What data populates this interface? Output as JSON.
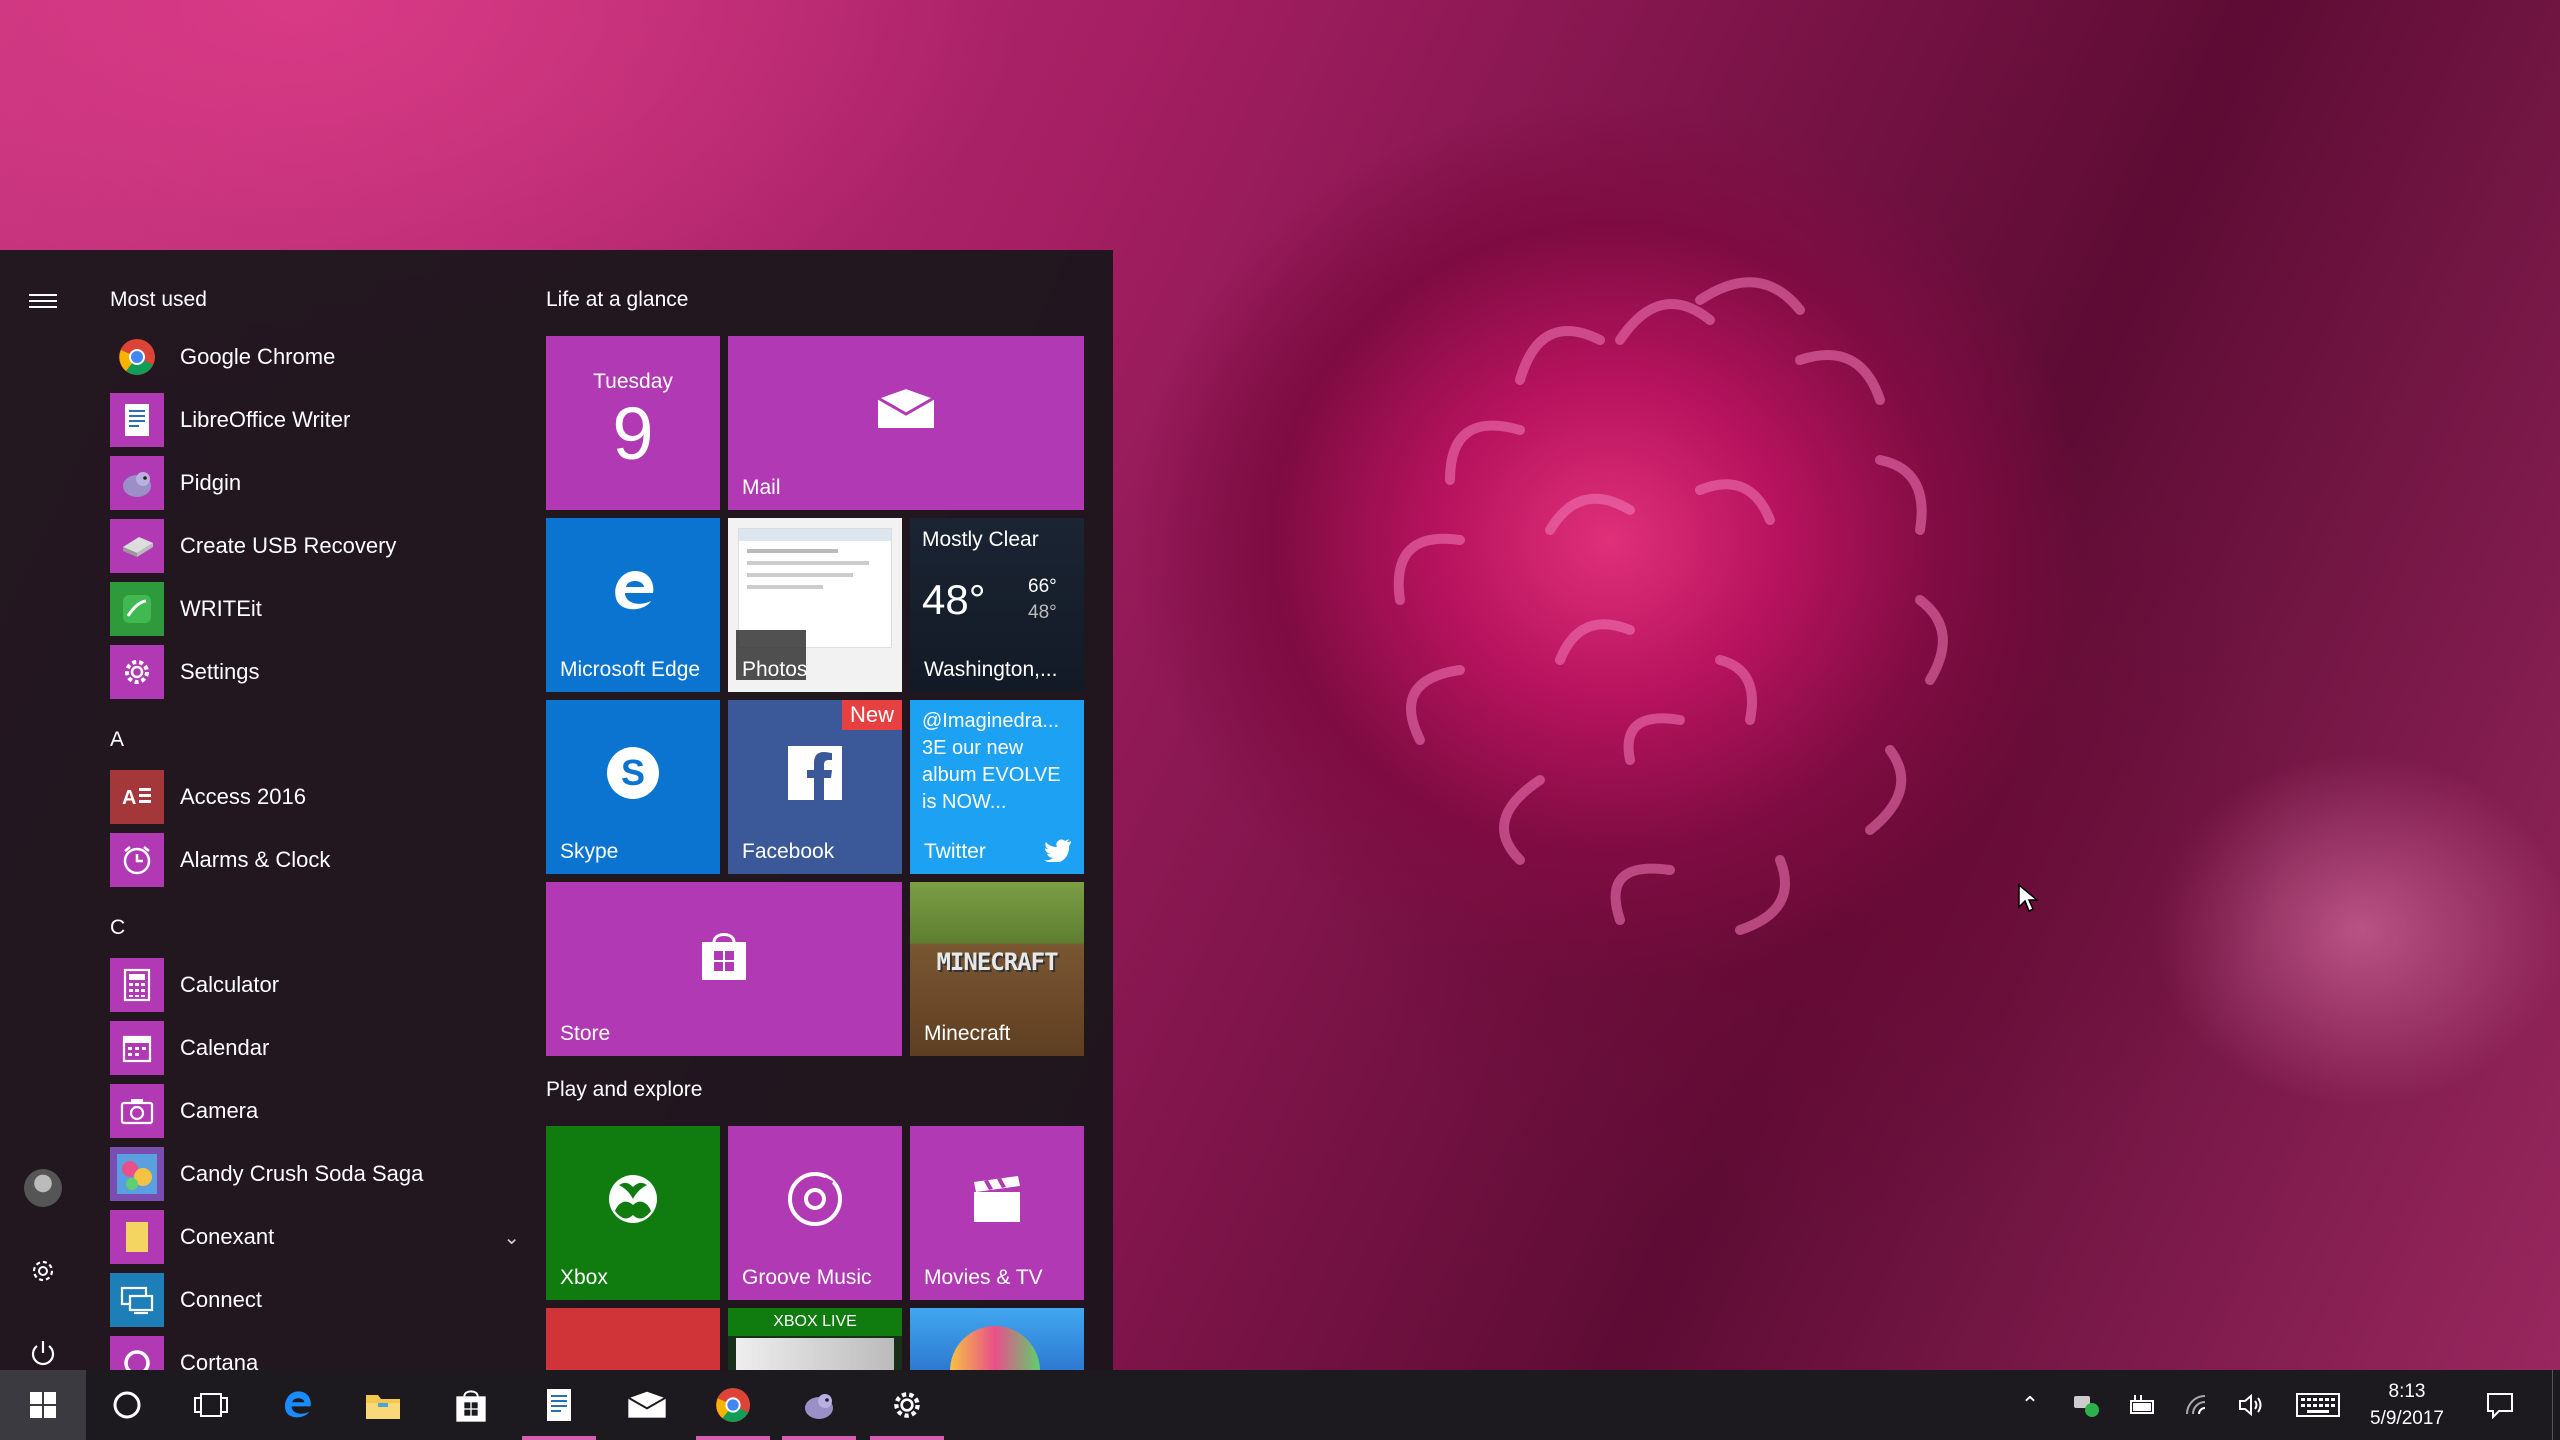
{
  "start": {
    "most_used_title": "Most used",
    "most_used": [
      {
        "label": "Google Chrome",
        "icon": "chrome-icon",
        "bg": "transparent"
      },
      {
        "label": "LibreOffice Writer",
        "icon": "libreoffice-writer-icon",
        "bg": "#b13ab4"
      },
      {
        "label": "Pidgin",
        "icon": "pidgin-icon",
        "bg": "#b13ab4"
      },
      {
        "label": "Create USB Recovery",
        "icon": "usb-recovery-icon",
        "bg": "#b13ab4"
      },
      {
        "label": "WRITEit",
        "icon": "writeit-icon",
        "bg": "#2e9a3c"
      },
      {
        "label": "Settings",
        "icon": "gear-icon",
        "bg": "#b13ab4"
      }
    ],
    "section_a": "A",
    "a_apps": [
      {
        "label": "Access 2016",
        "icon": "access-icon",
        "bg": "#a4373a"
      },
      {
        "label": "Alarms & Clock",
        "icon": "alarm-clock-icon",
        "bg": "#b13ab4"
      }
    ],
    "section_c": "C",
    "c_apps": [
      {
        "label": "Calculator",
        "icon": "calculator-icon",
        "bg": "#b13ab4"
      },
      {
        "label": "Calendar",
        "icon": "calendar-icon",
        "bg": "#b13ab4"
      },
      {
        "label": "Camera",
        "icon": "camera-icon",
        "bg": "#b13ab4"
      },
      {
        "label": "Candy Crush Soda Saga",
        "icon": "candy-crush-icon",
        "bg": "#7a4db0"
      },
      {
        "label": "Conexant",
        "icon": "folder-icon",
        "bg": "#b13ab4"
      },
      {
        "label": "Connect",
        "icon": "connect-icon",
        "bg": "#1e7fb8"
      },
      {
        "label": "Cortana",
        "icon": "cortana-icon",
        "bg": "#b13ab4"
      }
    ]
  },
  "tiles": {
    "group1_title": "Life at a glance",
    "calendar": {
      "day": "Tuesday",
      "date": "9"
    },
    "mail": "Mail",
    "edge": "Microsoft Edge",
    "photos": "Photos",
    "weather": {
      "condition": "Mostly Clear",
      "temp": "48°",
      "high": "66°",
      "low": "48°",
      "city": "Washington,..."
    },
    "skype": "Skype",
    "facebook": {
      "label": "Facebook",
      "badge": "New"
    },
    "twitter": {
      "text": "@Imaginedra... 3E our new album EVOLVE is NOW...",
      "label": "Twitter"
    },
    "store": "Store",
    "minecraft": {
      "label": "Minecraft",
      "logo": "MINECRAFT"
    },
    "group2_title": "Play and explore",
    "xbox": "Xbox",
    "groove": "Groove Music",
    "movies": "Movies & TV",
    "xbox_live": "XBOX LIVE"
  },
  "taskbar": {
    "clock_time": "8:13",
    "clock_date": "5/9/2017"
  },
  "colors": {
    "accent": "#b13ab4",
    "edge_blue": "#0a74d0",
    "facebook_blue": "#3b5998",
    "twitter_blue": "#1da1f2",
    "xbox_green": "#107c10"
  }
}
